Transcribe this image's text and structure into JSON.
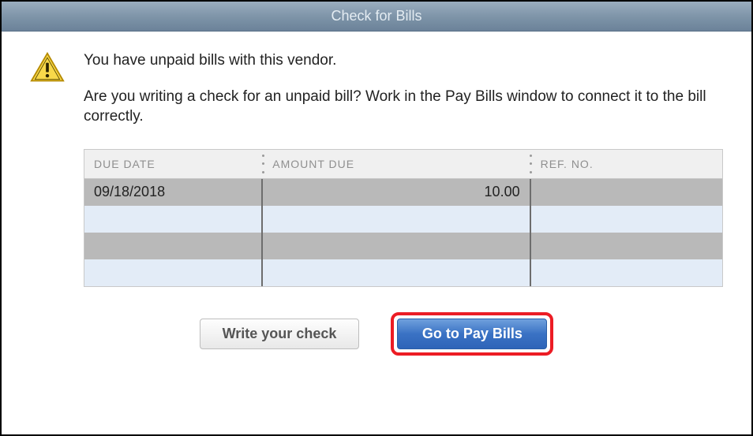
{
  "window": {
    "title": "Check for Bills"
  },
  "message": {
    "line1": "You have unpaid bills with this vendor.",
    "line2": "Are you writing a check for an unpaid bill? Work in the Pay Bills window to connect it to the bill correctly."
  },
  "table": {
    "headers": {
      "due_date": "DUE DATE",
      "amount_due": "AMOUNT DUE",
      "ref_no": "REF. NO."
    },
    "rows": [
      {
        "due_date": "09/18/2018",
        "amount_due": "10.00",
        "ref_no": ""
      },
      {
        "due_date": "",
        "amount_due": "",
        "ref_no": ""
      },
      {
        "due_date": "",
        "amount_due": "",
        "ref_no": ""
      },
      {
        "due_date": "",
        "amount_due": "",
        "ref_no": ""
      }
    ]
  },
  "buttons": {
    "write_check": "Write your check",
    "go_to_pay_bills": "Go to Pay Bills"
  }
}
